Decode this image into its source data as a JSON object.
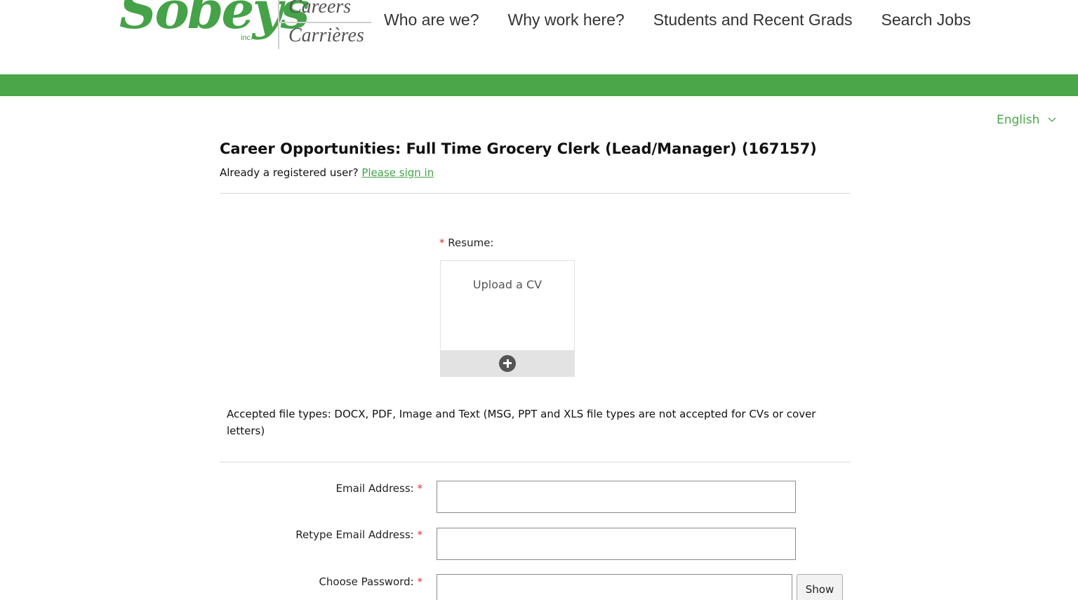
{
  "brand": {
    "logo_text": "Sobeys",
    "logo_suffix": "inc.",
    "careers": "Careers",
    "carrieres": "Carrières",
    "accent_color": "#4aa648"
  },
  "nav": {
    "items": [
      {
        "label": "Who are we?"
      },
      {
        "label": "Why work here?"
      },
      {
        "label": "Students and Recent Grads"
      },
      {
        "label": "Search Jobs"
      }
    ]
  },
  "language": {
    "selected": "English",
    "icon": "chevron-down-icon"
  },
  "page": {
    "title": "Career Opportunities: Full Time Grocery Clerk (Lead/Manager) (167157)",
    "registered_prompt": "Already a registered user?",
    "signin_link": "Please sign in"
  },
  "resume": {
    "required_mark": "*",
    "label": "Resume:",
    "upload_text": "Upload a CV",
    "add_icon": "plus-circle-icon",
    "accepted_types": "Accepted file types: DOCX, PDF, Image and Text (MSG, PPT and XLS file types are not accepted for CVs or cover letters)"
  },
  "form": {
    "required_mark": "*",
    "email_label": "Email Address:",
    "email_value": "",
    "retype_email_label": "Retype Email Address:",
    "retype_email_value": "",
    "password_label": "Choose Password:",
    "password_value": "",
    "show_button": "Show"
  }
}
